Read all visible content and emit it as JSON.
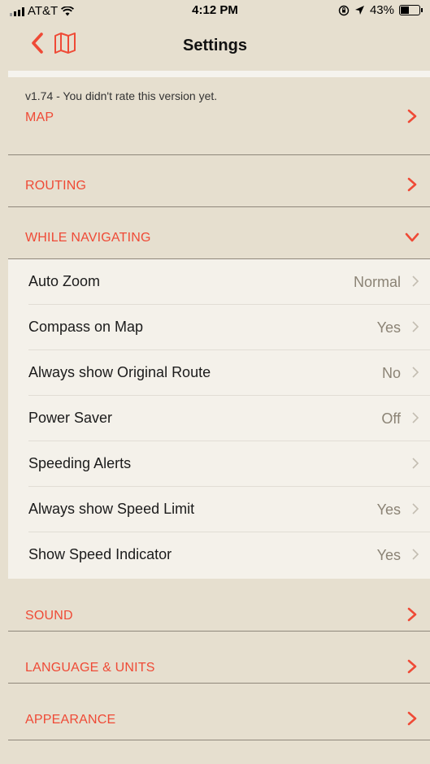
{
  "status_bar": {
    "carrier": "AT&T",
    "time": "4:12 PM",
    "battery": "43%",
    "battery_level": 0.43
  },
  "nav": {
    "title": "Settings",
    "back_icon": "chevron-left-icon",
    "map_icon": "map-icon"
  },
  "version_text": "v1.74 - You didn't rate this version yet.",
  "sections": {
    "map": "MAP",
    "routing": "ROUTING",
    "while_navigating": "WHILE NAVIGATING",
    "sound": "SOUND",
    "language_units": "LANGUAGE & UNITS",
    "appearance": "APPEARANCE"
  },
  "while_navigating_items": [
    {
      "label": "Auto Zoom",
      "value": "Normal"
    },
    {
      "label": "Compass on Map",
      "value": "Yes"
    },
    {
      "label": "Always show Original Route",
      "value": "No"
    },
    {
      "label": "Power Saver",
      "value": "Off"
    },
    {
      "label": "Speeding Alerts",
      "value": ""
    },
    {
      "label": "Always show Speed Limit",
      "value": "Yes"
    },
    {
      "label": "Show Speed Indicator",
      "value": "Yes"
    }
  ],
  "colors": {
    "accent": "#ef4a36",
    "background": "#e6dfcf",
    "list_background": "#f4f1ea"
  }
}
